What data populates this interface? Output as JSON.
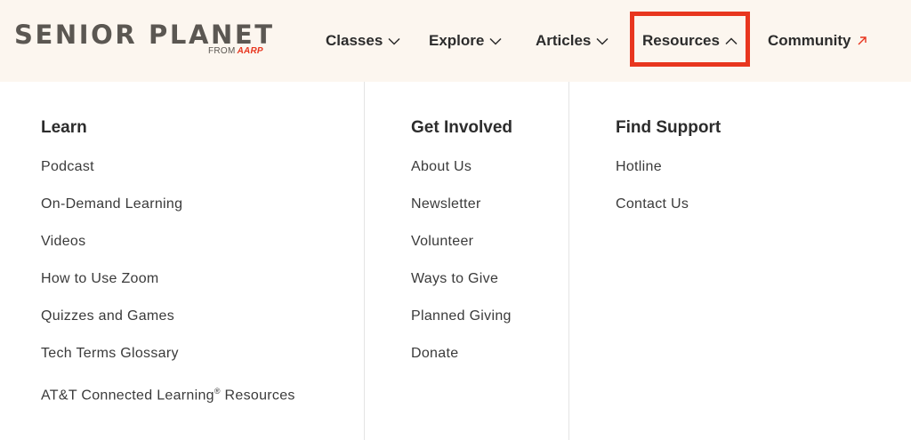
{
  "logo": {
    "main": "SENIOR PLANET",
    "from": "FROM",
    "brand": "AARP"
  },
  "nav": [
    {
      "label": "Classes",
      "icon": "chevron-down-icon"
    },
    {
      "label": "Explore",
      "icon": "chevron-down-icon"
    },
    {
      "label": "Articles",
      "icon": "chevron-down-icon"
    },
    {
      "label": "Resources",
      "icon": "chevron-up-icon"
    },
    {
      "label": "Community",
      "icon": "external-arrow-icon"
    }
  ],
  "colors": {
    "accent": "#e8361f",
    "header_bg": "#fcf6ef",
    "text": "#2c2c2c"
  },
  "menu": {
    "learn": {
      "heading": "Learn",
      "items": [
        "Podcast",
        "On-Demand Learning",
        "Videos",
        "How to Use Zoom",
        "Quizzes and Games",
        "Tech Terms Glossary",
        "AT&T Connected Learning"
      ],
      "att_reg": "®",
      "att_suffix": " Resources"
    },
    "get_involved": {
      "heading": "Get Involved",
      "items": [
        "About Us",
        "Newsletter",
        "Volunteer",
        "Ways to Give",
        "Planned Giving",
        "Donate"
      ]
    },
    "find_support": {
      "heading": "Find Support",
      "items": [
        "Hotline",
        "Contact Us"
      ]
    }
  }
}
